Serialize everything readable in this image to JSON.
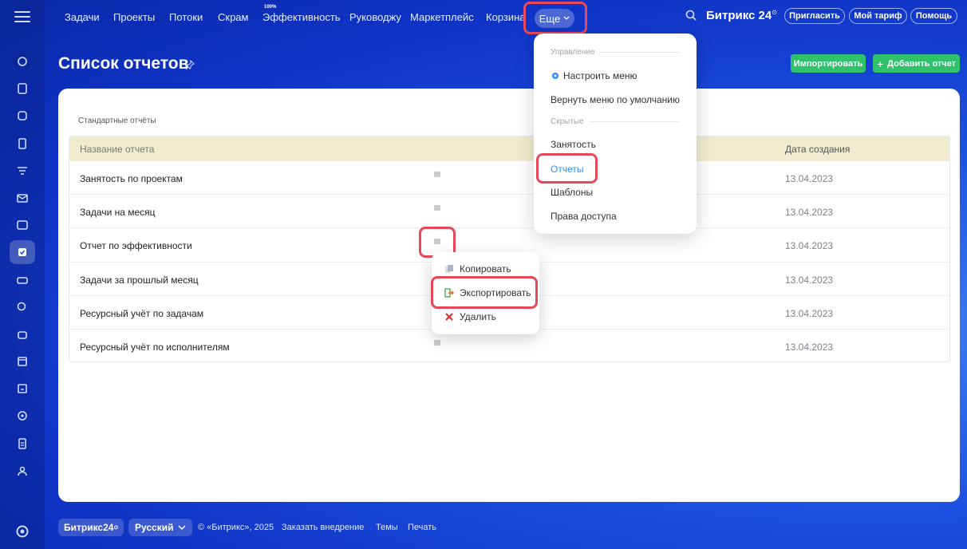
{
  "nav": {
    "items": [
      "Задачи",
      "Проекты",
      "Потоки",
      "Скрам",
      "Эффективность",
      "Руководжу",
      "Маркетплейс",
      "Корзина"
    ],
    "efficiency_badge": "100%",
    "more_label": "Еще",
    "logo": "Битрикс 24",
    "invite_label": "Пригласить",
    "tariff_label": "Мой тариф",
    "help_label": "Помощь"
  },
  "page": {
    "title": "Список отчетов",
    "import_label": "Импортировать",
    "add_report_label": "Добавить отчет"
  },
  "table": {
    "section_label": "Стандартные отчёты",
    "col_name": "Название отчета",
    "col_date": "Дата создания",
    "rows": [
      {
        "name": "Занятость по проектам",
        "date": "13.04.2023"
      },
      {
        "name": "Задачи на месяц",
        "date": "13.04.2023"
      },
      {
        "name": "Отчет по эффективности",
        "date": "13.04.2023"
      },
      {
        "name": "Задачи за прошлый месяц",
        "date": "13.04.2023"
      },
      {
        "name": "Ресурсный учёт по задачам",
        "date": "13.04.2023"
      },
      {
        "name": "Ресурсный учёт по исполнителям",
        "date": "13.04.2023"
      }
    ]
  },
  "more_menu": {
    "group_manage": "Управление",
    "configure_menu": "Настроить меню",
    "reset_menu": "Вернуть меню по умолчанию",
    "group_hidden": "Скрытые",
    "hidden_items": [
      "Занятость",
      "Отчеты",
      "Шаблоны",
      "Права доступа"
    ]
  },
  "row_menu": {
    "copy": "Копировать",
    "export": "Экспортировать",
    "delete": "Удалить"
  },
  "footer": {
    "logo": "Битрикс24",
    "language": "Русский",
    "copyright": "© «Битрикс», 2025",
    "order": "Заказать внедрение",
    "themes": "Темы",
    "print": "Печать"
  },
  "colors": {
    "accent_green": "#2fc26b",
    "highlight_red": "#e8485a",
    "link_blue": "#2d8cff"
  }
}
